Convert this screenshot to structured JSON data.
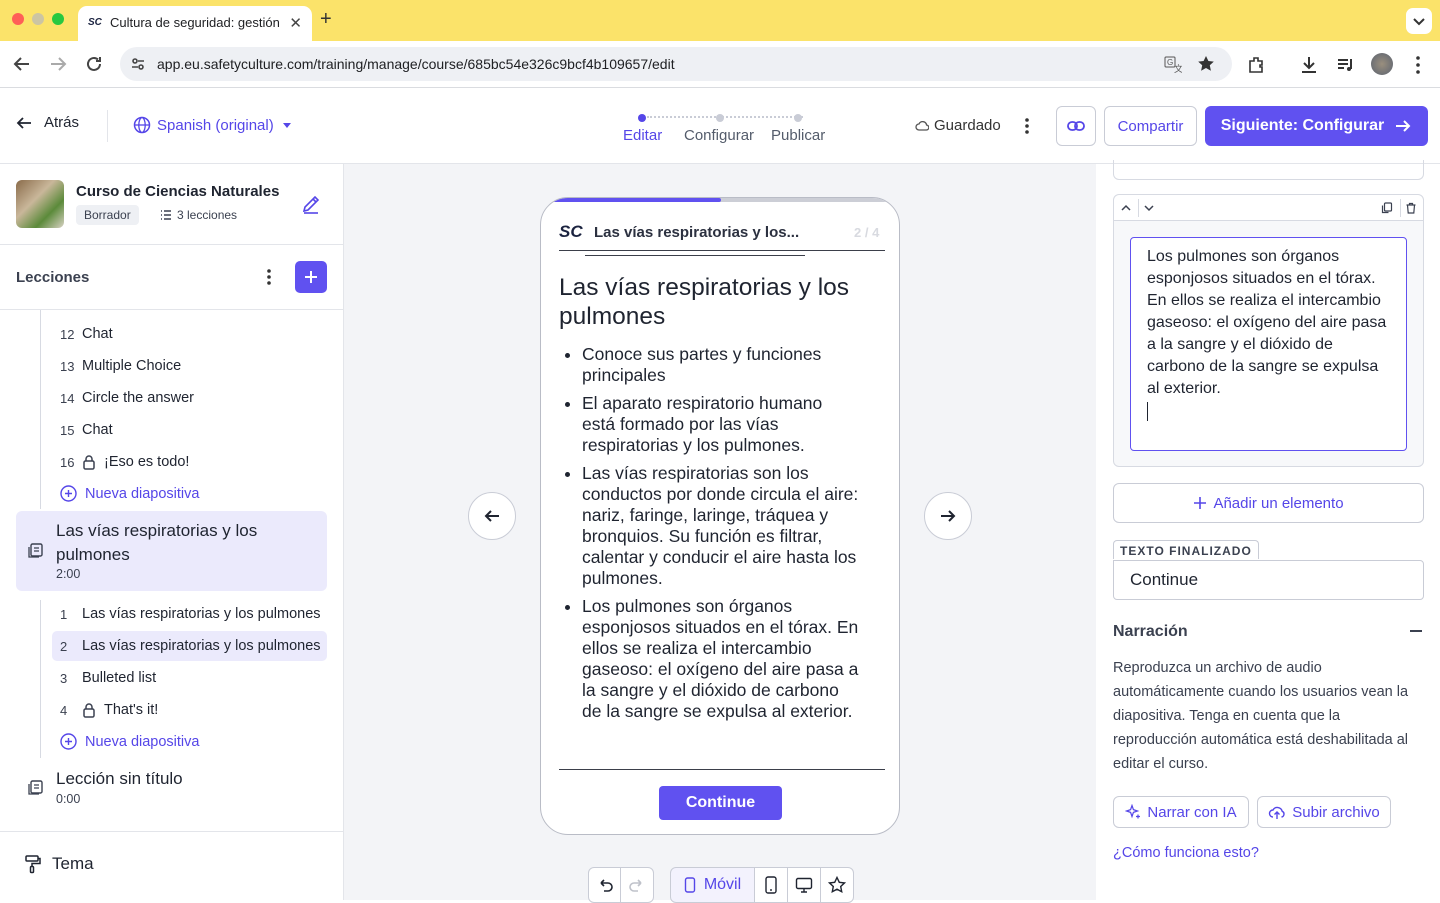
{
  "browser": {
    "tab_title": "Cultura de seguridad: gestión",
    "favicon_text": "SC",
    "url": "app.eu.safetyculture.com/training/manage/course/685bc54e326c9bcf4b109657/edit"
  },
  "header": {
    "back_label": "Atrás",
    "language": "Spanish (original)",
    "steps": [
      "Editar",
      "Configurar",
      "Publicar"
    ],
    "saved_label": "Guardado",
    "share_label": "Compartir",
    "next_label": "Siguiente: Configurar"
  },
  "sidebar": {
    "course_title": "Curso de Ciencias Naturales",
    "status_badge": "Borrador",
    "lesson_count": "3 lecciones",
    "lessons_heading": "Lecciones",
    "prev_slides": [
      {
        "num": "12",
        "label": "Chat"
      },
      {
        "num": "13",
        "label": "Multiple Choice"
      },
      {
        "num": "14",
        "label": "Circle the answer"
      },
      {
        "num": "15",
        "label": "Chat"
      },
      {
        "num": "16",
        "label": "¡Eso es todo!"
      }
    ],
    "new_slide_label": "Nueva diapositiva",
    "current_lesson": {
      "title": "Las vías respiratorias y los pulmones",
      "duration": "2:00"
    },
    "current_slides": [
      {
        "num": "1",
        "label": "Las vías respiratorias y los pulmones"
      },
      {
        "num": "2",
        "label": "Las vías respiratorias y los pulmones"
      },
      {
        "num": "3",
        "label": "Bulleted list"
      },
      {
        "num": "4",
        "label": "That's it!"
      }
    ],
    "untitled_lesson": {
      "title": "Lección sin título",
      "duration": "0:00"
    },
    "theme_label": "Tema"
  },
  "preview": {
    "logo": "SC",
    "header_title": "Las vías respiratorias y los...",
    "counter": "2 / 4",
    "progress": 0.5,
    "heading": "Las vías respiratorias y los pulmones",
    "bullets": [
      "Conoce sus partes y funciones principales",
      "El aparato respiratorio humano está formado por las vías respiratorias y los pulmones.",
      "Las vías respiratorias son los conductos por donde circula el aire: nariz, faringe, laringe, tráquea y bronquios. Su función es filtrar, calentar y conducir el aire hasta los pulmones.",
      "Los pulmones son órganos esponjosos situados en el tórax. En ellos se realiza el intercambio gaseoso: el oxígeno del aire pasa a la sangre y el dióxido de carbono de la sangre se expulsa al exterior."
    ],
    "continue_label": "Continue",
    "device_label": "Móvil"
  },
  "panel": {
    "editor_text": "Los pulmones son órganos esponjosos situados en el tórax. En ellos se realiza el intercambio gaseoso: el oxígeno del aire pasa a la sangre y el dióxido de carbono de la sangre se expulsa al exterior.",
    "add_element_label": "Añadir un elemento",
    "finish_text_label": "TEXTO FINALIZADO",
    "finish_text_value": "Continue",
    "narration_heading": "Narración",
    "narration_desc": "Reproduzca un archivo de audio automáticamente cuando los usuarios vean la diapositiva. Tenga en cuenta que la reproducción automática está deshabilitada al editar el curso.",
    "narrate_ai_label": "Narrar con IA",
    "upload_label": "Subir archivo",
    "how_link": "¿Cómo funciona esto?"
  },
  "colors": {
    "accent": "#6051f0",
    "tabbar": "#fbe36a",
    "selected": "#ebeafc"
  }
}
